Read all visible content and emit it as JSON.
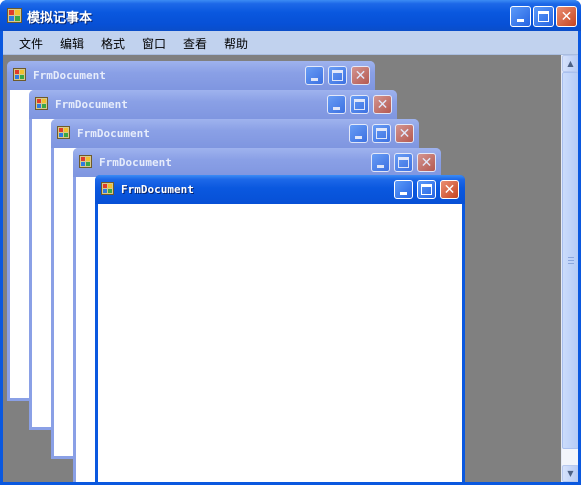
{
  "window": {
    "title": "模拟记事本",
    "icon": "notepad-app-icon",
    "controls": {
      "minimize": "minimize-icon",
      "maximize": "maximize-icon",
      "close": "close-icon",
      "close_glyph": "✕"
    }
  },
  "menu": {
    "items": [
      {
        "label": "文件"
      },
      {
        "label": "编辑"
      },
      {
        "label": "格式"
      },
      {
        "label": "窗口"
      },
      {
        "label": "查看"
      },
      {
        "label": "帮助"
      }
    ]
  },
  "mdi": {
    "background": "#808080",
    "children": [
      {
        "title": "FrmDocument",
        "active": false
      },
      {
        "title": "FrmDocument",
        "active": false
      },
      {
        "title": "FrmDocument",
        "active": false
      },
      {
        "title": "FrmDocument",
        "active": false
      },
      {
        "title": "FrmDocument",
        "active": true
      }
    ]
  },
  "scrollbar": {
    "up_glyph": "▲",
    "down_glyph": "▼"
  },
  "colors": {
    "titlebar_active": "#0a58df",
    "titlebar_inactive": "#8aa0e6",
    "menubar": "#c1d2ee",
    "close_button": "#c64420"
  }
}
